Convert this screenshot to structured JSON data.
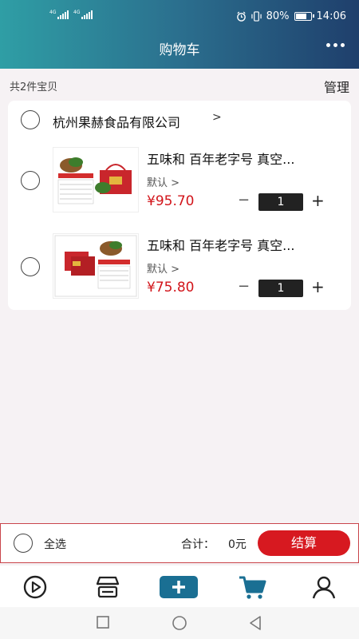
{
  "status": {
    "signal1": "4G",
    "signal2": "4G",
    "battery_pct": "80%",
    "battery_level": 0.8,
    "time": "14:06"
  },
  "header": {
    "title": "购物车",
    "more_icon": "more-dots-icon"
  },
  "cart": {
    "summary": "共2件宝贝",
    "manage_label": "管理"
  },
  "shop": {
    "name": "杭州果赫食品有限公司",
    "arrow": ">"
  },
  "items": [
    {
      "name": "五味和 百年老字号 真空...",
      "spec": "默认 >",
      "price": "¥95.70",
      "qty": "1",
      "minus": "−",
      "plus": "+"
    },
    {
      "name": "五味和 百年老字号 真空...",
      "spec": "默认 >",
      "price": "¥75.80",
      "qty": "1",
      "minus": "−",
      "plus": "+"
    }
  ],
  "checkout": {
    "select_all": "全选",
    "total_label": "合计：",
    "total_value": "0元",
    "button": "结算"
  },
  "tabs": [
    "play-icon",
    "store-icon",
    "add-icon",
    "cart-icon",
    "user-icon"
  ],
  "colors": {
    "accent": "#d71920",
    "active_tab": "#1a6f93",
    "header_start": "#2f9ea5",
    "header_end": "#1f3f6c"
  }
}
